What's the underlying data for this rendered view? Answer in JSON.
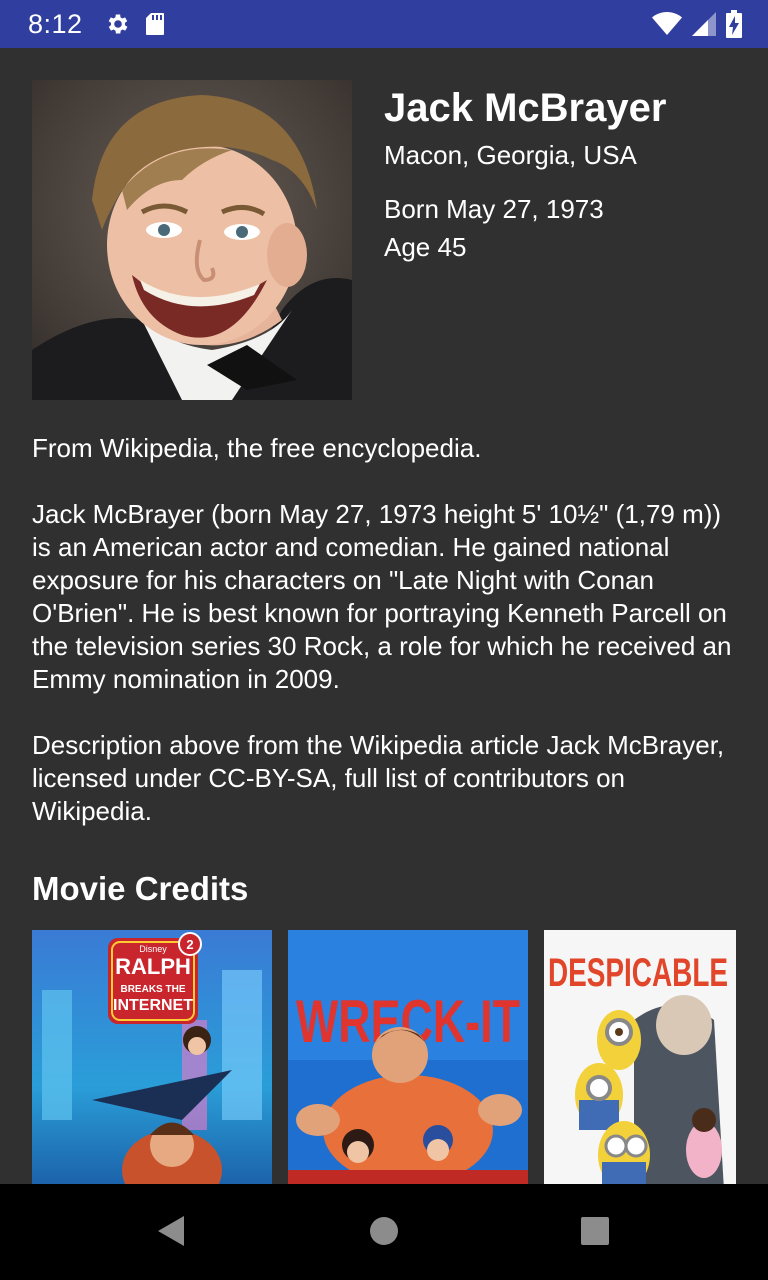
{
  "status_bar": {
    "time": "8:12",
    "icons": [
      "gear-icon",
      "sd-card-icon",
      "wifi-icon",
      "signal-icon",
      "battery-icon"
    ]
  },
  "person": {
    "name": "Jack McBrayer",
    "birthplace": "Macon, Georgia, USA",
    "born": "Born May 27, 1973",
    "age": "Age 45"
  },
  "bio": {
    "source_line": "From Wikipedia, the free encyclopedia.",
    "description": "Jack McBrayer (born May 27, 1973 height 5' 10½\" (1,79 m)) is an American actor and comedian. He gained national exposure for his characters on \"Late Night with Conan O'Brien\". He is best known for portraying Kenneth Parcell on the television series 30 Rock, a role for which he received an Emmy nomination in 2009.",
    "license": "Description above from the Wikipedia article Jack McBrayer, licensed under CC-BY-SA, full list of contributors on Wikipedia."
  },
  "credits": {
    "title": "Movie Credits",
    "posters": [
      {
        "logo_text": "RALPH BREAKS THE INTERNET",
        "badge": "2",
        "studio": "Disney"
      },
      {
        "logo_text": "WRECK-IT"
      },
      {
        "logo_text": "DESPICABLE"
      }
    ]
  },
  "colors": {
    "status_bar": "#303f9f",
    "background": "#303030",
    "nav_bar": "#000000"
  }
}
